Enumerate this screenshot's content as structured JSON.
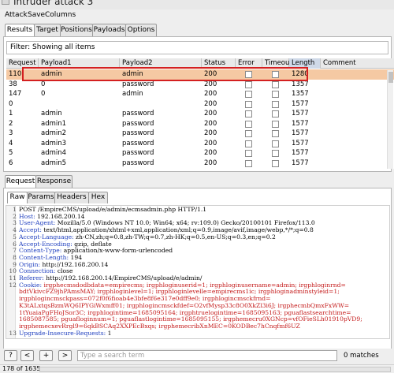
{
  "window": {
    "title": "Intruder attack 3"
  },
  "menu": [
    "Attack",
    "Save",
    "Columns"
  ],
  "top_tabs": [
    "Results",
    "Target",
    "Positions",
    "Payloads",
    "Options"
  ],
  "filter_text": "Filter: Showing all items",
  "table": {
    "columns": [
      "Request",
      "Payload1",
      "Payload2",
      "Status",
      "Error",
      "Timeout",
      "Length",
      "Comment"
    ],
    "rows": [
      [
        "110",
        "admin",
        "admin",
        "200",
        "",
        "",
        "1280",
        ""
      ],
      [
        "38",
        "0",
        "password",
        "200",
        "",
        "",
        "1357",
        ""
      ],
      [
        "147",
        "0",
        "admin",
        "200",
        "",
        "",
        "1357",
        ""
      ],
      [
        "0",
        "",
        "",
        "200",
        "",
        "",
        "1577",
        ""
      ],
      [
        "1",
        "admin",
        "password",
        "200",
        "",
        "",
        "1577",
        ""
      ],
      [
        "2",
        "admin1",
        "password",
        "200",
        "",
        "",
        "1577",
        ""
      ],
      [
        "3",
        "admin2",
        "password",
        "200",
        "",
        "",
        "1577",
        ""
      ],
      [
        "4",
        "admin3",
        "password",
        "200",
        "",
        "",
        "1577",
        ""
      ],
      [
        "5",
        "admin4",
        "password",
        "200",
        "",
        "",
        "1577",
        ""
      ],
      [
        "6",
        "admin5",
        "password",
        "200",
        "",
        "",
        "1577",
        ""
      ]
    ],
    "selected_row_index": 0
  },
  "detail_tabs": [
    "Request",
    "Response"
  ],
  "view_tabs": [
    "Raw",
    "Params",
    "Headers",
    "Hex"
  ],
  "request_lines": [
    {
      "n": "1",
      "key": "",
      "val": "POST /EmpireCMS/upload/e/admin/ecmsadmin.php HTTP/1.1"
    },
    {
      "n": "2",
      "key": "Host:",
      "val": " 192.168.200.14"
    },
    {
      "n": "3",
      "key": "User-Agent:",
      "val": " Mozilla/5.0 (Windows NT 10.0; Win64; x64; rv:109.0) Gecko/20100101 Firefox/113.0"
    },
    {
      "n": "4",
      "key": "Accept:",
      "val": " text/html,application/xhtml+xml,application/xml;q=0.9,image/avif,image/webp,*/*;q=0.8"
    },
    {
      "n": "5",
      "key": "Accept-Language:",
      "val": " zh-CN,zh;q=0.8,zh-TW;q=0.7,zh-HK;q=0.5,en-US;q=0.3,en;q=0.2"
    },
    {
      "n": "6",
      "key": "Accept-Encoding:",
      "val": " gzip, deflate"
    },
    {
      "n": "7",
      "key": "Content-Type:",
      "val": " application/x-www-form-urlencoded"
    },
    {
      "n": "8",
      "key": "Content-Length:",
      "val": " 194"
    },
    {
      "n": "9",
      "key": "Origin:",
      "val": " http://192.168.200.14"
    },
    {
      "n": "10",
      "key": "Connection:",
      "val": " close"
    },
    {
      "n": "11",
      "key": "Referer:",
      "val": " http://192.168.200.14/EmpireCMS/upload/e/admin/"
    },
    {
      "n": "12",
      "key": "Cookie:",
      "val": " irgphecmsdodbdata=empirecms; irgphloginuserid=1; irgphloginusername=admin; irgphloginrnd="
    },
    {
      "n": "",
      "key": "",
      "val": "bdtVkivcFZ9jhPAmsMAY; irgphloginlevel=1; irgphloginlevelle=empirecms1ic; irgphloginadminstyleid=1;"
    },
    {
      "n": "",
      "key": "",
      "val": "irgphlogincmsckpass=072f0f6fioab4e3bfe8f6e317e0dff9e0; irgphlogincmsckfrnd="
    },
    {
      "n": "",
      "key": "",
      "val": "K3tALxtqsBzmWQ6IPYGiWxmff01; irgphlogincmsckfdef=O2vfMysp33c8O0XkZl3i6J; irgphecmbQmxFxWW="
    },
    {
      "n": "",
      "key": "",
      "val": "1tYuaiaPgFHoJSor3C; irgphlogintime=1685095164; irgphtruelogintime=1685095163; pguaflastsearchtime="
    },
    {
      "n": "",
      "key": "",
      "val": "1685087585; pguafloginnum=1; pguaflastlogintime=1685095155; irgphemecru0XGNcp=vfOFieSLh01910pVD9;"
    },
    {
      "n": "",
      "key": "",
      "val": "irgphemecxevRrgl9=6qkBSCAq2XXPEcBxqs; irgphemecribXnMEC=0KODBec7hCnqfmf6UZ"
    },
    {
      "n": "13",
      "key": "Upgrade-Insecure-Requests:",
      "val": " 1"
    }
  ],
  "search": {
    "placeholder": "Type a search term",
    "matches": "0 matches"
  },
  "buttons": {
    "help": "?",
    "prev": "<",
    "next": "+",
    "fwd": ">"
  },
  "status": "178 of 1635"
}
